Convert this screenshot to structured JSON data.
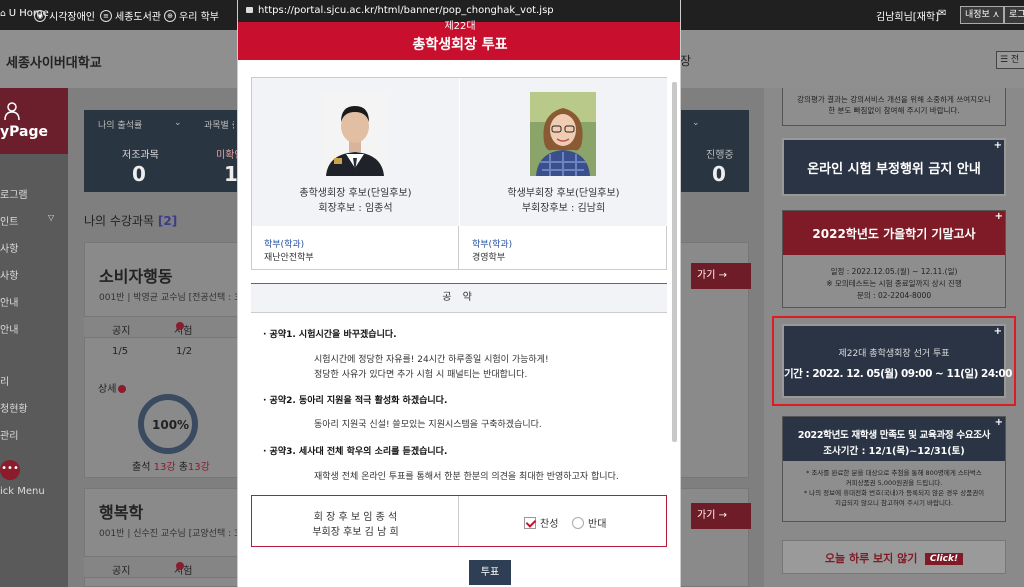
{
  "topbar": {
    "links": [
      "U Home",
      "시각장애인",
      "세종도서관",
      "우리 학부"
    ],
    "user": "김남희님[재학]",
    "info_btn": "내정보 ⋏",
    "logout_btn": "로그"
  },
  "header": {
    "logo": "세종사이버대학교",
    "frag": "장",
    "menu_btn": "☰ 전"
  },
  "sidebar": {
    "mypage": "yPage",
    "items": [
      "로그램",
      "인트",
      "사항",
      "사항",
      "안내",
      "안내",
      "리",
      "청현황",
      "관리"
    ],
    "quick_menu": "ick Menu"
  },
  "main": {
    "stat": {
      "label_a": "나의 출석률",
      "label_b": "과목별 출",
      "title_a": "저조과목",
      "title_b": "미확인",
      "value_a": "0",
      "value_b": "1",
      "title_c": "진행중",
      "value_c": "0"
    },
    "courses_heading": "나의 수강과목",
    "courses_count": "[2]",
    "course1": {
      "title": "소비자행동",
      "sub": "001반 | 박영균 교수님 [전공선택 : 3",
      "go": "가기 →",
      "col_a": "공지",
      "col_b": "시험",
      "val_a": "1/5",
      "val_b": "1/2",
      "detail": "상세",
      "progress": "100%",
      "attend_label": "출석",
      "attend_value": "13강",
      "total_label": "총",
      "total_value": "13강"
    },
    "course2": {
      "title": "행복학",
      "sub": "001반 | 신수진 교수님 [교양선택 : 3",
      "go": "가기 →",
      "col_a": "공지",
      "col_b": "시험"
    }
  },
  "right": {
    "survey_text_1": "강의평가 결과는 강의서비스 개선을 위해 소중하게 쓰여지오니",
    "survey_text_2": "한 분도 빠짐없이 참여해 주시기 바랍니다.",
    "banner1": "온라인 시험 부정행위 금지 안내",
    "banner2_title": "2022학년도 가을학기 기말고사",
    "banner2_l1": "일정 : 2022.12.05.(월) ~ 12.11.(일)",
    "banner2_l2": "※ 모의테스트는 시험 종료일까지 상시 진행",
    "banner2_l3": "문의 : 02-2204-8000",
    "banner3_l1": "제22대 총학생회장 선거 투표",
    "banner3_l2": "기간 : 2022. 12. 05(월) 09:00 ~ 11(일) 24:00",
    "banner4_l1": "2022학년도 재학생 만족도 및 교육과정 수요조사",
    "banner4_l2": "조사기간 : 12/1(목)~12/31(토)",
    "banner4_l3": "* 조사를 완료한 분을 대상으로 추첨을 통해 800명에게 스타벅스",
    "banner4_l4": "커피상품권 5,000원권을 드립니다.",
    "banner4_l5": "* 나의 정보에 휴대전화 번호(국내)가 등록되지 않은 경우 상품권이",
    "banner4_l6": "지급되지 않으니 참고하여 주시기 바랍니다.",
    "no_show": "오늘 하루 보지 않기",
    "click": "Click!"
  },
  "popup": {
    "url": "https://portal.sjcu.ac.kr/html/banner/pop_chonghak_vot.jsp",
    "title_small": "제22대",
    "title": "총학생회장 투표",
    "candidate1": {
      "line1": "총학생회장 후보(단일후보)",
      "line2": "회장후보 : 임종석",
      "dept_label": "학부(학과)",
      "dept": "재난안전학부"
    },
    "candidate2": {
      "line1": "학생부회장 후보(단일후보)",
      "line2": "부회장후보 : 김남희",
      "dept_label": "학부(학과)",
      "dept": "경영학부"
    },
    "pledge_title": "공 약",
    "pledges": [
      {
        "head": "· 공약1. 시험시간을 바꾸겠습니다.",
        "body": [
          "시험시간에 정당한 자유를! 24시간 하루종일 시험이 가능하게!",
          "정당한 사유가 있다면 추가 시험 시 패널티는 반대합니다."
        ]
      },
      {
        "head": "· 공약2. 동아리 지원을 적극 활성화 하겠습니다.",
        "body": [
          "동아리 지원국 신설! 쓸모있는 지원시스템을 구축하겠습니다."
        ]
      },
      {
        "head": "· 공약3. 세사대 전체 학우의 소리를 듣겠습니다.",
        "body": [
          "재학생 전체 온라인 투표를 통해서 한분 한분의 의견을 최대한 반영하고자 합니다."
        ]
      }
    ],
    "vote_names_1": "회 장 후 보 임 종 석",
    "vote_names_2": "부회장 후보 김 남 희",
    "agree": "찬성",
    "oppose": "반대",
    "vote_button": "투표"
  }
}
